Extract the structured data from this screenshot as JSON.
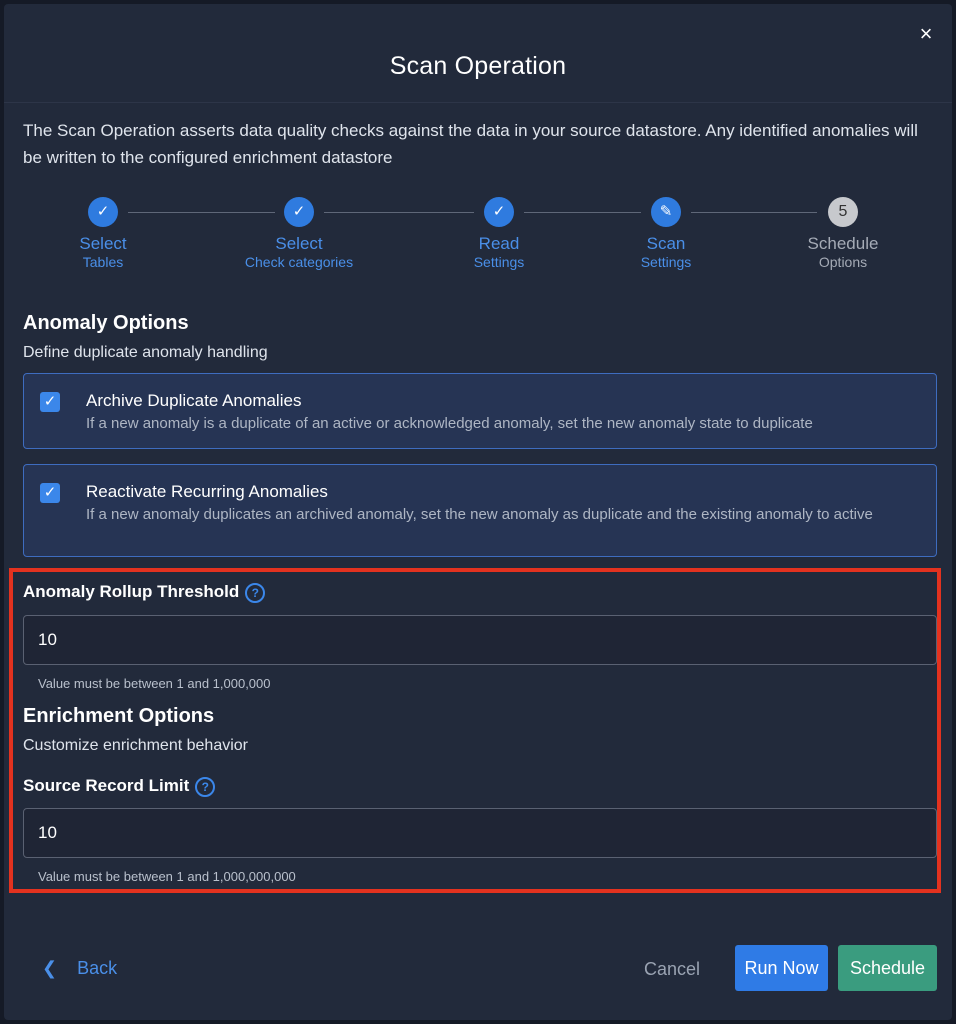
{
  "modal": {
    "title": "Scan Operation",
    "close_icon": "×",
    "description": "The Scan Operation asserts data quality checks against the data in your source datastore. Any identified anomalies will be written to the configured enrichment datastore"
  },
  "stepper": {
    "steps": [
      {
        "line1": "Select",
        "line2": "Tables",
        "state": "done",
        "glyph": "✓"
      },
      {
        "line1": "Select",
        "line2": "Check categories",
        "state": "done",
        "glyph": "✓"
      },
      {
        "line1": "Read",
        "line2": "Settings",
        "state": "done",
        "glyph": "✓"
      },
      {
        "line1": "Scan",
        "line2": "Settings",
        "state": "active",
        "glyph": "✎"
      },
      {
        "line1": "Schedule",
        "line2": "Options",
        "state": "pending",
        "glyph": "5"
      }
    ]
  },
  "anomaly_options": {
    "title": "Anomaly Options",
    "subtitle": "Define duplicate anomaly handling",
    "archive": {
      "checked": true,
      "title": "Archive Duplicate Anomalies",
      "description": "If a new anomaly is a duplicate of an active or acknowledged anomaly, set the new anomaly state to duplicate"
    },
    "reactivate": {
      "checked": true,
      "title": "Reactivate Recurring Anomalies",
      "description": "If a new anomaly duplicates an archived anomaly, set the new anomaly as duplicate and the existing anomaly to active"
    }
  },
  "rollup": {
    "label": "Anomaly Rollup Threshold",
    "value": "10",
    "hint": "Value must be between 1 and 1,000,000"
  },
  "enrichment": {
    "title": "Enrichment Options",
    "subtitle": "Customize enrichment behavior",
    "source_limit": {
      "label": "Source Record Limit",
      "value": "10",
      "hint": "Value must be between 1 and 1,000,000,000"
    }
  },
  "footer": {
    "back_label": "Back",
    "cancel_label": "Cancel",
    "run_now_label": "Run Now",
    "schedule_label": "Schedule"
  },
  "colors": {
    "accent": "#2f7be6",
    "schedule_button": "#3a9c7f",
    "highlight_border": "#e3321f"
  }
}
